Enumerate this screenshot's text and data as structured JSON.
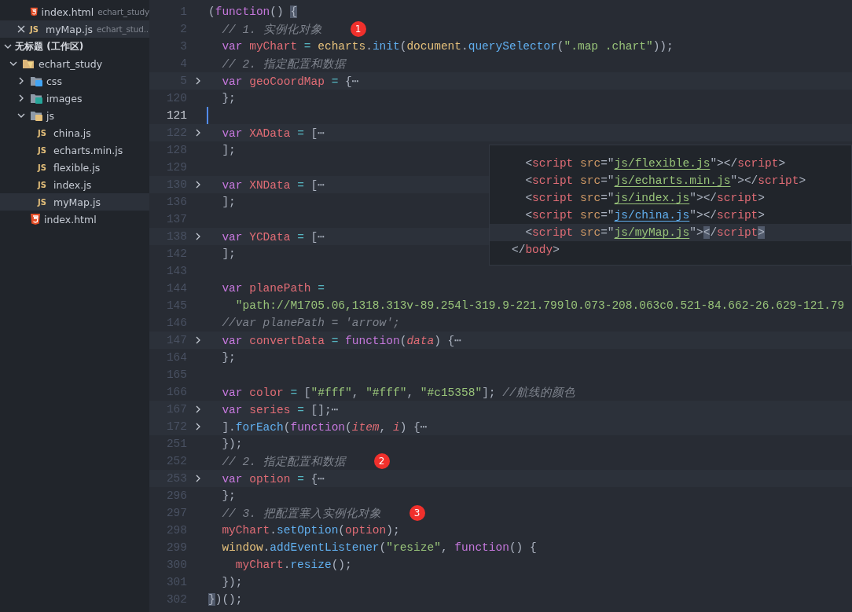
{
  "sidebar": {
    "open_editors": [
      {
        "name": "index.html",
        "folder": "echart_study",
        "kind": "html",
        "selected": false
      },
      {
        "name": "myMap.js",
        "folder": "echart_stud...",
        "kind": "js",
        "icon_text": "JS",
        "selected": true
      }
    ],
    "workspace": {
      "title": "无标题 (工作区)",
      "expanded": true,
      "tree": [
        {
          "name": "echart_study",
          "kind": "folder",
          "expanded": true,
          "selected": false,
          "children": [
            {
              "name": "css",
              "kind": "css",
              "expanded": false,
              "selected": false
            },
            {
              "name": "images",
              "kind": "images",
              "expanded": false,
              "selected": false
            },
            {
              "name": "js",
              "kind": "scripts",
              "expanded": true,
              "selected": false,
              "children": [
                {
                  "name": "china.js",
                  "kind": "js",
                  "icon_text": "JS",
                  "selected": false
                },
                {
                  "name": "echarts.min.js",
                  "kind": "js",
                  "icon_text": "JS",
                  "selected": false
                },
                {
                  "name": "flexible.js",
                  "kind": "js",
                  "icon_text": "JS",
                  "selected": false
                },
                {
                  "name": "index.js",
                  "kind": "js",
                  "icon_text": "JS",
                  "selected": false
                },
                {
                  "name": "myMap.js",
                  "kind": "js",
                  "icon_text": "JS",
                  "selected": true
                }
              ]
            },
            {
              "name": "index.html",
              "kind": "html",
              "selected": false
            }
          ]
        }
      ]
    }
  },
  "editor": {
    "lines": [
      {
        "number": "1",
        "fold": false,
        "current": false,
        "tokens": [
          {
            "kind": "punct",
            "text": "("
          },
          {
            "kind": "keyword",
            "text": "function"
          },
          {
            "kind": "punct",
            "text": "() "
          },
          {
            "kind": "match",
            "text": "{"
          }
        ]
      },
      {
        "number": "2",
        "fold": false,
        "current": false,
        "badge": "1",
        "tokens": [
          {
            "kind": "comment",
            "text": "  // 1. 实例化对象"
          }
        ]
      },
      {
        "number": "3",
        "fold": false,
        "current": false,
        "tokens": [
          {
            "kind": "keyword",
            "text": "  var "
          },
          {
            "kind": "variable",
            "text": "myChart "
          },
          {
            "kind": "operator",
            "text": "= "
          },
          {
            "kind": "object",
            "text": "echarts"
          },
          {
            "kind": "punct",
            "text": "."
          },
          {
            "kind": "function",
            "text": "init"
          },
          {
            "kind": "punct",
            "text": "("
          },
          {
            "kind": "object",
            "text": "document"
          },
          {
            "kind": "punct",
            "text": "."
          },
          {
            "kind": "function",
            "text": "querySelector"
          },
          {
            "kind": "punct",
            "text": "("
          },
          {
            "kind": "string",
            "text": "\".map .chart\""
          },
          {
            "kind": "punct",
            "text": "));"
          }
        ]
      },
      {
        "number": "4",
        "fold": false,
        "current": false,
        "tokens": [
          {
            "kind": "comment",
            "text": "  // 2. 指定配置和数据"
          }
        ]
      },
      {
        "number": "5",
        "fold": true,
        "current": false,
        "tokens": [
          {
            "kind": "keyword",
            "text": "  var "
          },
          {
            "kind": "variable",
            "text": "geoCoordMap "
          },
          {
            "kind": "operator",
            "text": "= "
          },
          {
            "kind": "punct",
            "text": "{"
          },
          {
            "kind": "fold",
            "text": "⋯"
          }
        ]
      },
      {
        "number": "120",
        "fold": false,
        "current": false,
        "tokens": [
          {
            "kind": "punct",
            "text": "  };"
          }
        ]
      },
      {
        "number": "121",
        "fold": false,
        "current": true
      },
      {
        "number": "122",
        "fold": true,
        "current": false,
        "tokens": [
          {
            "kind": "keyword",
            "text": "  var "
          },
          {
            "kind": "variable",
            "text": "XAData "
          },
          {
            "kind": "operator",
            "text": "= "
          },
          {
            "kind": "punct",
            "text": "["
          },
          {
            "kind": "fold",
            "text": "⋯"
          }
        ]
      },
      {
        "number": "128",
        "fold": false,
        "current": false,
        "tokens": [
          {
            "kind": "punct",
            "text": "  ];"
          }
        ]
      },
      {
        "number": "129",
        "fold": false,
        "current": false
      },
      {
        "number": "130",
        "fold": true,
        "current": false,
        "tokens": [
          {
            "kind": "keyword",
            "text": "  var "
          },
          {
            "kind": "variable",
            "text": "XNData "
          },
          {
            "kind": "operator",
            "text": "= "
          },
          {
            "kind": "punct",
            "text": "["
          },
          {
            "kind": "fold",
            "text": "⋯"
          }
        ]
      },
      {
        "number": "136",
        "fold": false,
        "current": false,
        "tokens": [
          {
            "kind": "punct",
            "text": "  ];"
          }
        ]
      },
      {
        "number": "137",
        "fold": false,
        "current": false
      },
      {
        "number": "138",
        "fold": true,
        "current": false,
        "tokens": [
          {
            "kind": "keyword",
            "text": "  var "
          },
          {
            "kind": "variable",
            "text": "YCData "
          },
          {
            "kind": "operator",
            "text": "= "
          },
          {
            "kind": "punct",
            "text": "["
          },
          {
            "kind": "fold",
            "text": "⋯"
          }
        ]
      },
      {
        "number": "142",
        "fold": false,
        "current": false,
        "tokens": [
          {
            "kind": "punct",
            "text": "  ];"
          }
        ]
      },
      {
        "number": "143",
        "fold": false,
        "current": false
      },
      {
        "number": "144",
        "fold": false,
        "current": false,
        "tokens": [
          {
            "kind": "keyword",
            "text": "  var "
          },
          {
            "kind": "variable",
            "text": "planePath "
          },
          {
            "kind": "operator",
            "text": "="
          }
        ]
      },
      {
        "number": "145",
        "fold": false,
        "current": false,
        "tokens": [
          {
            "kind": "string",
            "text": "    \"path://M1705.06,1318.313v-89.254l-319.9-221.799l0.073-208.063c0.521-84.662-26.629-121.79"
          }
        ]
      },
      {
        "number": "146",
        "fold": false,
        "current": false,
        "tokens": [
          {
            "kind": "comment",
            "text": "  //var planePath = 'arrow';"
          }
        ]
      },
      {
        "number": "147",
        "fold": true,
        "current": false,
        "tokens": [
          {
            "kind": "keyword",
            "text": "  var "
          },
          {
            "kind": "variable",
            "text": "convertData "
          },
          {
            "kind": "operator",
            "text": "= "
          },
          {
            "kind": "keyword",
            "text": "function"
          },
          {
            "kind": "punct",
            "text": "("
          },
          {
            "kind": "param",
            "text": "data"
          },
          {
            "kind": "punct",
            "text": ") {"
          },
          {
            "kind": "fold",
            "text": "⋯"
          }
        ]
      },
      {
        "number": "164",
        "fold": false,
        "current": false,
        "tokens": [
          {
            "kind": "punct",
            "text": "  };"
          }
        ]
      },
      {
        "number": "165",
        "fold": false,
        "current": false
      },
      {
        "number": "166",
        "fold": false,
        "current": false,
        "tokens": [
          {
            "kind": "keyword",
            "text": "  var "
          },
          {
            "kind": "variable",
            "text": "color "
          },
          {
            "kind": "operator",
            "text": "= "
          },
          {
            "kind": "punct",
            "text": "["
          },
          {
            "kind": "string",
            "text": "\"#fff\""
          },
          {
            "kind": "punct",
            "text": ", "
          },
          {
            "kind": "string",
            "text": "\"#fff\""
          },
          {
            "kind": "punct",
            "text": ", "
          },
          {
            "kind": "string",
            "text": "\"#c15358\""
          },
          {
            "kind": "punct",
            "text": "]; "
          },
          {
            "kind": "comment",
            "text": "//航线的颜色"
          }
        ]
      },
      {
        "number": "167",
        "fold": true,
        "current": false,
        "tokens": [
          {
            "kind": "keyword",
            "text": "  var "
          },
          {
            "kind": "variable",
            "text": "series "
          },
          {
            "kind": "operator",
            "text": "= "
          },
          {
            "kind": "punct",
            "text": "[];"
          },
          {
            "kind": "fold",
            "text": "⋯"
          }
        ]
      },
      {
        "number": "172",
        "fold": true,
        "current": false,
        "tokens": [
          {
            "kind": "punct",
            "text": "  ]."
          },
          {
            "kind": "function",
            "text": "forEach"
          },
          {
            "kind": "punct",
            "text": "("
          },
          {
            "kind": "keyword",
            "text": "function"
          },
          {
            "kind": "punct",
            "text": "("
          },
          {
            "kind": "param",
            "text": "item"
          },
          {
            "kind": "punct",
            "text": ", "
          },
          {
            "kind": "param",
            "text": "i"
          },
          {
            "kind": "punct",
            "text": ") {"
          },
          {
            "kind": "fold",
            "text": "⋯"
          }
        ]
      },
      {
        "number": "251",
        "fold": false,
        "current": false,
        "tokens": [
          {
            "kind": "punct",
            "text": "  });"
          }
        ]
      },
      {
        "number": "252",
        "fold": false,
        "current": false,
        "badge": "2",
        "tokens": [
          {
            "kind": "comment",
            "text": "  // 2. 指定配置和数据"
          }
        ]
      },
      {
        "number": "253",
        "fold": true,
        "current": false,
        "tokens": [
          {
            "kind": "keyword",
            "text": "  var "
          },
          {
            "kind": "variable",
            "text": "option "
          },
          {
            "kind": "operator",
            "text": "= "
          },
          {
            "kind": "punct",
            "text": "{"
          },
          {
            "kind": "fold",
            "text": "⋯"
          }
        ]
      },
      {
        "number": "296",
        "fold": false,
        "current": false,
        "tokens": [
          {
            "kind": "punct",
            "text": "  };"
          }
        ]
      },
      {
        "number": "297",
        "fold": false,
        "current": false,
        "badge": "3",
        "tokens": [
          {
            "kind": "comment",
            "text": "  // 3. 把配置塞入实例化对象"
          }
        ]
      },
      {
        "number": "298",
        "fold": false,
        "current": false,
        "tokens": [
          {
            "kind": "variable",
            "text": "  myChart"
          },
          {
            "kind": "punct",
            "text": "."
          },
          {
            "kind": "function",
            "text": "setOption"
          },
          {
            "kind": "punct",
            "text": "("
          },
          {
            "kind": "variable",
            "text": "option"
          },
          {
            "kind": "punct",
            "text": ");"
          }
        ]
      },
      {
        "number": "299",
        "fold": false,
        "current": false,
        "tokens": [
          {
            "kind": "object",
            "text": "  window"
          },
          {
            "kind": "punct",
            "text": "."
          },
          {
            "kind": "function",
            "text": "addEventListener"
          },
          {
            "kind": "punct",
            "text": "("
          },
          {
            "kind": "string",
            "text": "\"resize\""
          },
          {
            "kind": "punct",
            "text": ", "
          },
          {
            "kind": "keyword",
            "text": "function"
          },
          {
            "kind": "punct",
            "text": "() {"
          }
        ]
      },
      {
        "number": "300",
        "fold": false,
        "current": false,
        "tokens": [
          {
            "kind": "variable",
            "text": "    myChart"
          },
          {
            "kind": "punct",
            "text": "."
          },
          {
            "kind": "function",
            "text": "resize"
          },
          {
            "kind": "punct",
            "text": "();"
          }
        ]
      },
      {
        "number": "301",
        "fold": false,
        "current": false,
        "tokens": [
          {
            "kind": "punct",
            "text": "  });"
          }
        ]
      },
      {
        "number": "302",
        "fold": false,
        "current": false,
        "tokens": [
          {
            "kind": "match",
            "text": "}"
          },
          {
            "kind": "punct",
            "text": ")();"
          }
        ]
      }
    ]
  },
  "peek": {
    "lines": [
      {
        "current": false,
        "tokens": [
          {
            "kind": "bracket",
            "text": "  <"
          },
          {
            "kind": "tag",
            "text": "script "
          },
          {
            "kind": "attr",
            "text": "src"
          },
          {
            "kind": "punct",
            "text": "=\""
          },
          {
            "kind": "link",
            "text": "js/flexible.js"
          },
          {
            "kind": "punct",
            "text": "\""
          },
          {
            "kind": "bracket",
            "text": "></"
          },
          {
            "kind": "tag",
            "text": "script"
          },
          {
            "kind": "bracket",
            "text": ">"
          }
        ]
      },
      {
        "current": false,
        "tokens": [
          {
            "kind": "bracket",
            "text": "  <"
          },
          {
            "kind": "tag",
            "text": "script "
          },
          {
            "kind": "attr",
            "text": "src"
          },
          {
            "kind": "punct",
            "text": "=\""
          },
          {
            "kind": "link",
            "text": "js/echarts.min.js"
          },
          {
            "kind": "punct",
            "text": "\""
          },
          {
            "kind": "bracket",
            "text": "></"
          },
          {
            "kind": "tag",
            "text": "script"
          },
          {
            "kind": "bracket",
            "text": ">"
          }
        ]
      },
      {
        "current": false,
        "tokens": [
          {
            "kind": "bracket",
            "text": "  <"
          },
          {
            "kind": "tag",
            "text": "script "
          },
          {
            "kind": "attr",
            "text": "src"
          },
          {
            "kind": "punct",
            "text": "=\""
          },
          {
            "kind": "link",
            "text": "js/index.js"
          },
          {
            "kind": "punct",
            "text": "\""
          },
          {
            "kind": "bracket",
            "text": "></"
          },
          {
            "kind": "tag",
            "text": "script"
          },
          {
            "kind": "bracket",
            "text": ">"
          }
        ]
      },
      {
        "current": false,
        "tokens": [
          {
            "kind": "bracket",
            "text": "  <"
          },
          {
            "kind": "tag",
            "text": "script "
          },
          {
            "kind": "attr",
            "text": "src"
          },
          {
            "kind": "punct",
            "text": "=\""
          },
          {
            "kind": "linkactive",
            "text": "js/china.js"
          },
          {
            "kind": "punct",
            "text": "\""
          },
          {
            "kind": "bracket",
            "text": "></"
          },
          {
            "kind": "tag",
            "text": "script"
          },
          {
            "kind": "bracket",
            "text": ">"
          }
        ]
      },
      {
        "current": true,
        "tokens": [
          {
            "kind": "bracket",
            "text": "  <"
          },
          {
            "kind": "tag",
            "text": "script "
          },
          {
            "kind": "attr",
            "text": "src"
          },
          {
            "kind": "punct",
            "text": "=\""
          },
          {
            "kind": "link",
            "text": "js/myMap.js"
          },
          {
            "kind": "punct",
            "text": "\""
          },
          {
            "kind": "bracket",
            "text": ">"
          },
          {
            "kind": "match",
            "text": "<"
          },
          {
            "kind": "bracket",
            "text": "/"
          },
          {
            "kind": "tag",
            "text": "script"
          },
          {
            "kind": "match",
            "text": ">"
          }
        ]
      },
      {
        "current": false,
        "tokens": [
          {
            "kind": "bracket",
            "text": "</"
          },
          {
            "kind": "tag",
            "text": "body"
          },
          {
            "kind": "bracket",
            "text": ">"
          }
        ]
      }
    ]
  }
}
